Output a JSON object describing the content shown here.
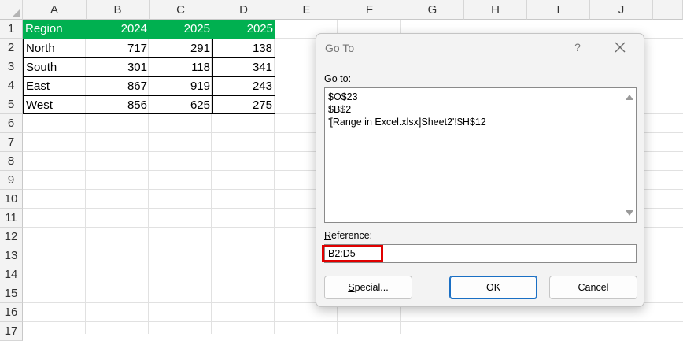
{
  "sheet": {
    "columns": [
      "A",
      "B",
      "C",
      "D",
      "E",
      "F",
      "G",
      "H",
      "I",
      "J"
    ],
    "rows": [
      "1",
      "2",
      "3",
      "4",
      "5",
      "6",
      "7",
      "8",
      "9",
      "10",
      "11",
      "12",
      "13",
      "14",
      "15",
      "16",
      "17"
    ],
    "table": {
      "header": [
        "Region",
        "2024",
        "2025",
        "2025"
      ],
      "data": [
        [
          "North",
          "717",
          "291",
          "138"
        ],
        [
          "South",
          "301",
          "118",
          "341"
        ],
        [
          "East",
          "867",
          "919",
          "243"
        ],
        [
          "West",
          "856",
          "625",
          "275"
        ]
      ]
    },
    "header_color": "#00b050"
  },
  "dialog": {
    "title": "Go To",
    "help": "?",
    "goto_label": "Go to:",
    "goto_items": [
      "$O$23",
      "$B$2",
      "'[Range in Excel.xlsx]Sheet2'!$H$12"
    ],
    "reference_label_underlined": "R",
    "reference_label_rest": "eference:",
    "reference_value": "B2:D5",
    "buttons": {
      "special_underlined": "S",
      "special_rest": "pecial...",
      "ok": "OK",
      "cancel": "Cancel"
    },
    "highlight_color": "#e00000"
  }
}
